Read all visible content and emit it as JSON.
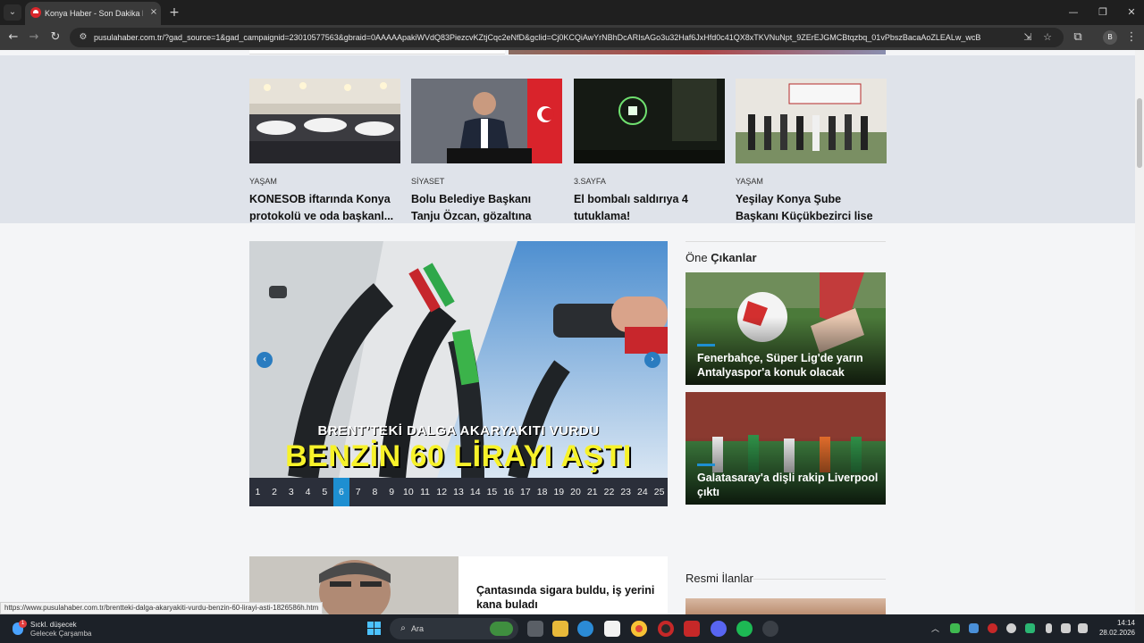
{
  "browser": {
    "tab_title": "Konya Haber - Son Dakika Konya",
    "tab_close": "×",
    "new_tab": "+",
    "url": "pusulahaber.com.tr/?gad_source=1&gad_campaignid=23010577563&gbraid=0AAAAApakiWVdQ83PiezcvKZtjCqc2eNfD&gclid=Cj0KCQiAwYrNBhDcARIsAGo3u32Haf6JxHfd0c41QX8xTKVNuNpt_9ZErEJGMCBtqzbq_01vPbszBacaAoZLEALw_wcB",
    "back": "←",
    "forward": "→",
    "reload": "↻",
    "site_info": "⚙",
    "minimize": "—",
    "restore": "❐",
    "close": "✕",
    "tab_list": "⌄",
    "install_icon": "⇲",
    "bookmark_icon": "☆",
    "extensions_icon": "⧉",
    "menu_icon": "⋮",
    "profile_initial": "B"
  },
  "news_band": [
    {
      "category": "YAŞAM",
      "title": "KONESOB iftarında Konya protokolü ve oda başkanl..."
    },
    {
      "category": "SİYASET",
      "title": "Bolu Belediye Başkanı Tanju Özcan, gözaltına alındı!"
    },
    {
      "category": "3.SAYFA",
      "title": "El bombalı saldırıya 4 tutuklama!"
    },
    {
      "category": "YAŞAM",
      "title": "Yeşilay Konya Şube Başkanı Küçükbezirci lise kulüpleri..."
    }
  ],
  "slider": {
    "subheadline": "BRENT’TEKİ DALGA AKARYAKITI VURDU",
    "headline": "BENZİN 60 LİRAYI AŞTI",
    "prev": "‹",
    "next": "›",
    "pages": [
      "1",
      "2",
      "3",
      "4",
      "5",
      "6",
      "7",
      "8",
      "9",
      "10",
      "11",
      "12",
      "13",
      "14",
      "15",
      "16",
      "17",
      "18",
      "19",
      "20",
      "21",
      "22",
      "23",
      "24",
      "25"
    ],
    "active_page": 6,
    "accent_color": "#1e8fd1"
  },
  "featured": {
    "heading_light": "Öne",
    "heading_bold": "Çıkanlar",
    "items": [
      {
        "title": "Fenerbahçe, Süper Lig'de yarın Antalyaspor'a konuk olacak"
      },
      {
        "title": "Galatasaray'a dişli rakip Liverpool çıktı"
      }
    ]
  },
  "bottom_article": {
    "title": "Çantasında sigara buldu, iş yerini kana buladı"
  },
  "resmi_ilanlar": {
    "heading": "Resmi İlanlar"
  },
  "status_bar": {
    "url": "https://www.pusulahaber.com.tr/brentteki-dalga-akaryakiti-vurdu-benzin-60-lirayi-asti-1826586h.htm"
  },
  "taskbar": {
    "weather_line1": "Sıckl. düşecek",
    "weather_line2": "Gelecek Çarşamba",
    "weather_badge": "1",
    "search_placeholder": "Ara",
    "search_icon": "⌕",
    "tray_chevron": "︿",
    "time": "14:14",
    "date": "28.02.2026"
  }
}
